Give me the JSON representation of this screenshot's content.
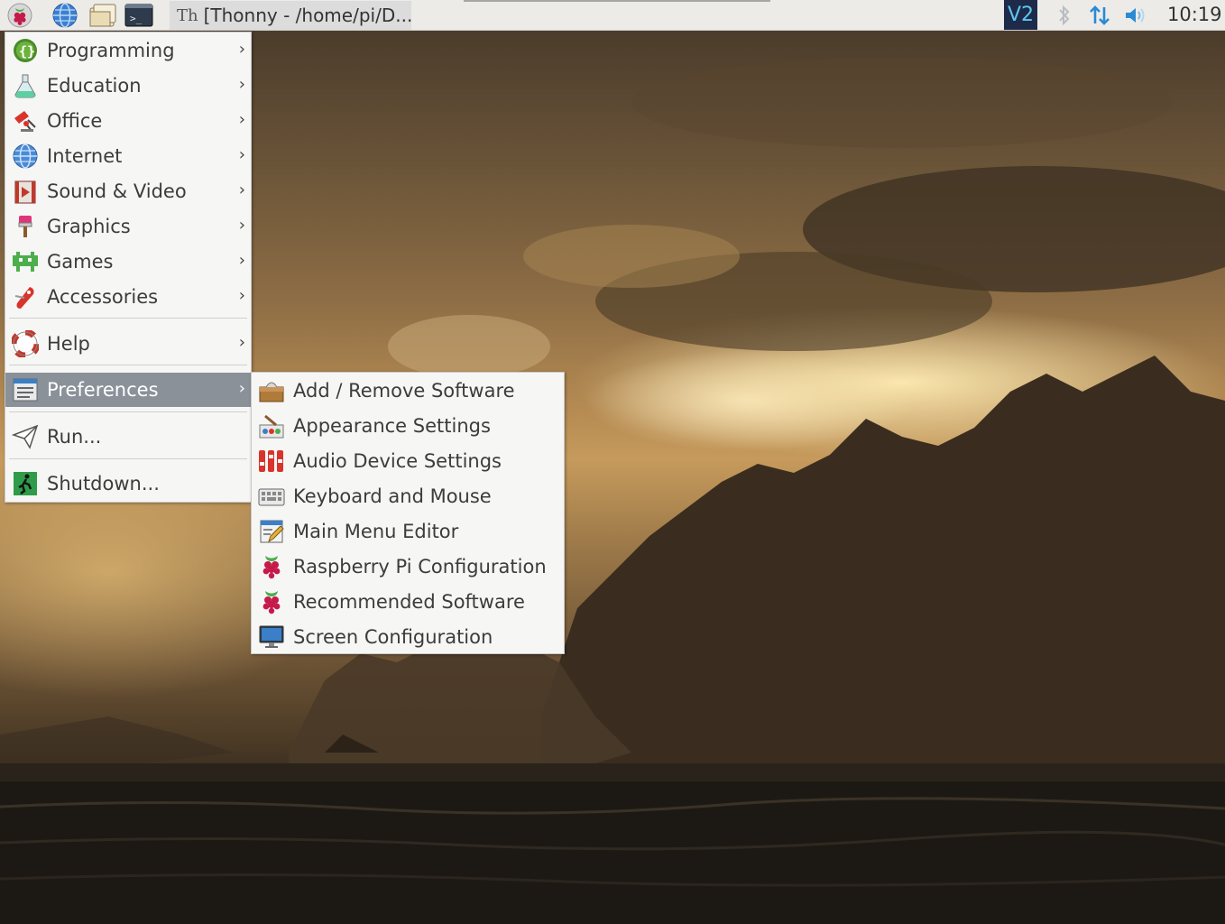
{
  "taskbar": {
    "menu_button_icon": "raspberry-icon",
    "launchers": [
      {
        "name": "web-browser",
        "icon": "globe-icon"
      },
      {
        "name": "file-manager",
        "icon": "folder-icon"
      },
      {
        "name": "terminal",
        "icon": "terminal-icon"
      }
    ],
    "task_label": "[Thonny  -  /home/pi/D...",
    "task_icon_text": "Th",
    "vnc_label": "V2",
    "tray_icons": [
      "bluetooth-icon",
      "network-icon",
      "volume-icon"
    ],
    "clock": "10:19",
    "accent_color": "#2a8ad4"
  },
  "main_menu": {
    "items": [
      {
        "label": "Programming",
        "icon": "programming-icon"
      },
      {
        "label": "Education",
        "icon": "education-icon"
      },
      {
        "label": "Office",
        "icon": "office-icon"
      },
      {
        "label": "Internet",
        "icon": "internet-icon"
      },
      {
        "label": "Sound & Video",
        "icon": "sound-video-icon"
      },
      {
        "label": "Graphics",
        "icon": "graphics-icon"
      },
      {
        "label": "Games",
        "icon": "games-icon"
      },
      {
        "label": "Accessories",
        "icon": "accessories-icon"
      },
      {
        "label": "Help",
        "icon": "help-icon"
      },
      {
        "label": "Preferences",
        "icon": "preferences-icon",
        "selected": true
      },
      {
        "label": "Run...",
        "icon": "run-icon"
      },
      {
        "label": "Shutdown...",
        "icon": "shutdown-icon"
      }
    ],
    "selected_color": "#8a9199"
  },
  "preferences_menu": {
    "items": [
      {
        "label": "Add / Remove Software",
        "icon": "package-icon"
      },
      {
        "label": "Appearance Settings",
        "icon": "appearance-icon"
      },
      {
        "label": "Audio Device Settings",
        "icon": "audio-mixer-icon"
      },
      {
        "label": "Keyboard and Mouse",
        "icon": "keyboard-icon"
      },
      {
        "label": "Main Menu Editor",
        "icon": "menu-editor-icon"
      },
      {
        "label": "Raspberry Pi Configuration",
        "icon": "raspberry-icon"
      },
      {
        "label": "Recommended Software",
        "icon": "raspberry-icon"
      },
      {
        "label": "Screen Configuration",
        "icon": "monitor-icon"
      }
    ]
  }
}
